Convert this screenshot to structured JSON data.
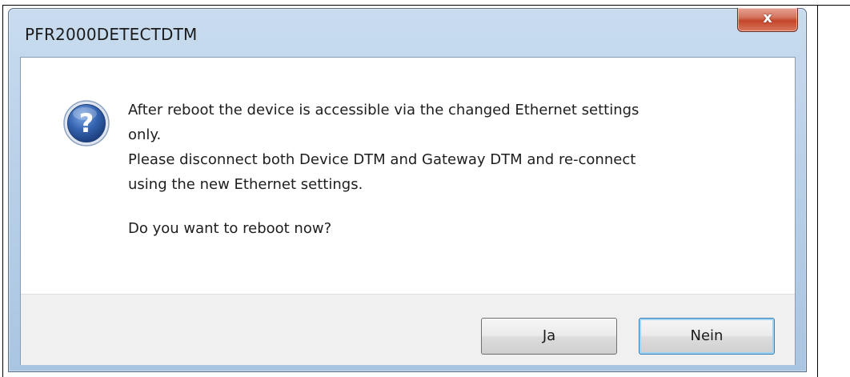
{
  "window": {
    "title": "PFR2000DETECTDTM",
    "close_glyph": "x"
  },
  "message": {
    "line1": "After reboot the device is accessible via the changed Ethernet settings",
    "line2": "only.",
    "line3": "Please disconnect both Device DTM and Gateway DTM and re-connect",
    "line4": "using the new Ethernet settings.",
    "question": "Do you want to reboot now?"
  },
  "buttons": {
    "yes_label": "Ja",
    "no_label": "Nein",
    "default_button": "Nein"
  },
  "icons": {
    "question": "question-icon",
    "close": "close-icon"
  },
  "colors": {
    "titlebar": "#b9d0e8",
    "close_button": "#c4452c",
    "question_icon": "#2f5fa8",
    "default_button_focus": "#3c7fb1"
  }
}
